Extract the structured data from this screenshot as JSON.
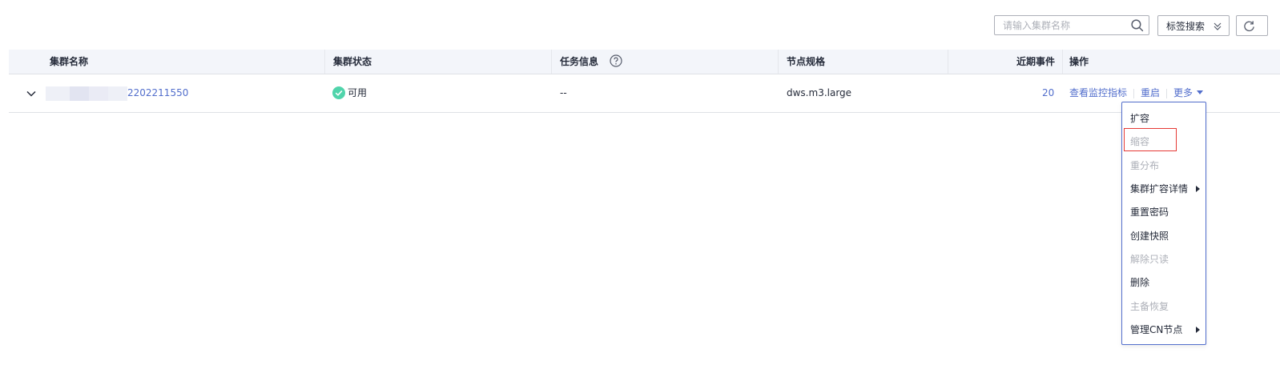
{
  "toolbar": {
    "search_placeholder": "请输入集群名称",
    "tag_search_label": "标签搜索"
  },
  "table": {
    "columns": {
      "name": "集群名称",
      "status": "集群状态",
      "task": "任务信息",
      "spec": "节点规格",
      "events": "近期事件",
      "ops": "操作"
    },
    "rows": [
      {
        "name_suffix": "2202211550",
        "status": "可用",
        "task": "--",
        "spec": "dws.m3.large",
        "events": "20",
        "op_monitor": "查看监控指标",
        "op_restart": "重启",
        "op_more": "更多"
      }
    ]
  },
  "more_menu": {
    "items": [
      {
        "label": "扩容",
        "disabled": false
      },
      {
        "label": "缩容",
        "disabled": true
      },
      {
        "label": "重分布",
        "disabled": true
      },
      {
        "label": "集群扩容详情",
        "disabled": false,
        "submenu": true
      },
      {
        "label": "重置密码",
        "disabled": false
      },
      {
        "label": "创建快照",
        "disabled": false
      },
      {
        "label": "解除只读",
        "disabled": true
      },
      {
        "label": "删除",
        "disabled": false
      },
      {
        "label": "主备恢复",
        "disabled": true
      },
      {
        "label": "管理CN节点",
        "disabled": false,
        "submenu": true
      }
    ]
  },
  "colors": {
    "link": "#526ecc",
    "status_ok": "#50d4ab",
    "highlight": "#e53935",
    "disabled_text": "#adb0b8"
  }
}
